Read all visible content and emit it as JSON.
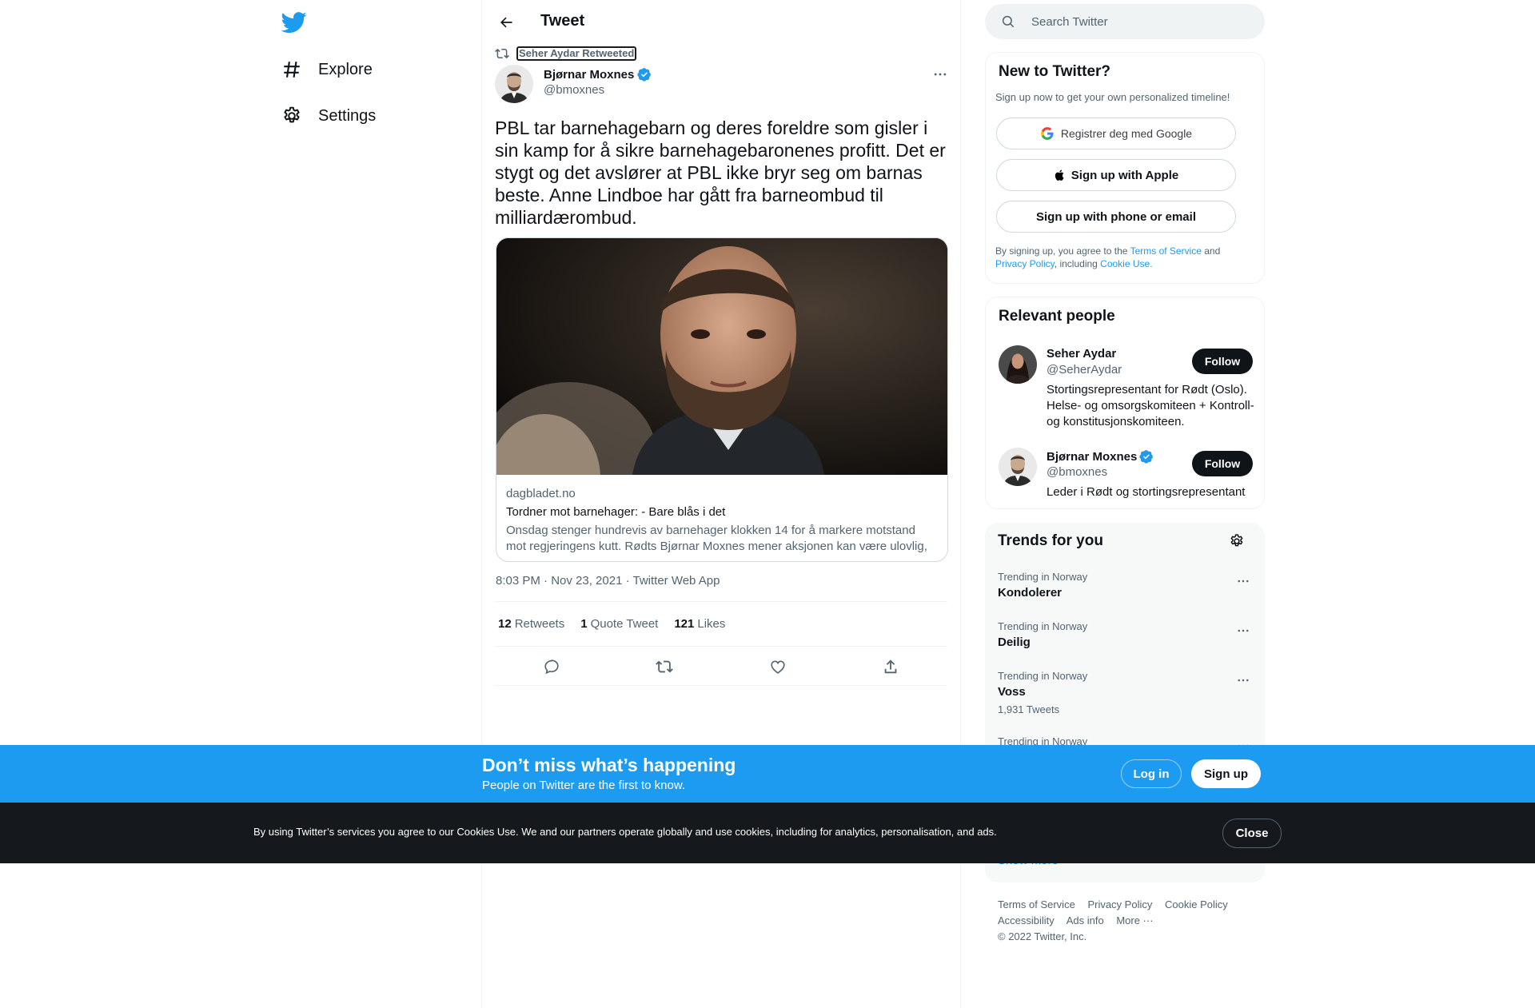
{
  "nav": {
    "logo": "twitter-bird-icon",
    "items": [
      {
        "label": "Explore",
        "icon": "hashtag-icon"
      },
      {
        "label": "Settings",
        "icon": "gear-icon"
      }
    ]
  },
  "header": {
    "title": "Tweet",
    "back_icon": "arrow-left-icon"
  },
  "tweet": {
    "retweeted_by": "Seher Aydar Retweeted",
    "author": {
      "name": "Bjørnar Moxnes",
      "handle": "@bmoxnes",
      "verified": true
    },
    "text": "PBL tar barnehagebarn og deres foreldre som gisler i sin kamp for å sikre barnehagebaronenes profitt. Det er stygt og det avslører at PBL ikke bryr seg om barnas beste. Anne Lindboe har gått fra barneombud til milliardærombud.",
    "card": {
      "domain": "dagbladet.no",
      "title": "Tordner mot barnehager: - Bare blås i det",
      "description": "Onsdag stenger hundrevis av barnehager klokken 14 for å markere motstand mot regjeringens kutt. Rødts Bjørnar Moxnes mener aksjonen kan være ulovlig, og ber barnehagene om å droppe den."
    },
    "meta": "8:03 PM · Nov 23, 2021 · Twitter Web App",
    "stats": {
      "retweets_count": "12",
      "retweets_label": "Retweets",
      "quotes_count": "1",
      "quotes_label": "Quote Tweet",
      "likes_count": "121",
      "likes_label": "Likes"
    },
    "actions": [
      "reply-icon",
      "retweet-icon",
      "like-icon",
      "share-icon"
    ]
  },
  "search": {
    "placeholder": "Search Twitter"
  },
  "new_to_twitter": {
    "title": "New to Twitter?",
    "subtitle": "Sign up now to get your own personalized timeline!",
    "google_label": "Registrer deg med Google",
    "apple_label": "Sign up with Apple",
    "phone_label": "Sign up with phone or email",
    "legal_prefix": "By signing up, you agree to the ",
    "terms": "Terms of Service",
    "and": " and",
    "privacy": "Privacy Policy",
    "including": ", including ",
    "cookie": "Cookie Use."
  },
  "relevant_people": {
    "title": "Relevant people",
    "people": [
      {
        "name": "Seher Aydar",
        "handle": "@SeherAydar",
        "verified": false,
        "bio": "Stortingsrepresentant for Rødt (Oslo). Helse- og omsorgskomiteen + Kontroll- og konstitusjonskomiteen.",
        "follow": "Follow"
      },
      {
        "name": "Bjørnar Moxnes",
        "handle": "@bmoxnes",
        "verified": true,
        "bio": "Leder i Rødt og stortingsrepresentant",
        "follow": "Follow"
      }
    ]
  },
  "trends": {
    "title": "Trends for you",
    "items": [
      {
        "context": "Trending in Norway",
        "name": "Kondolerer",
        "count": ""
      },
      {
        "context": "Trending in Norway",
        "name": "Deilig",
        "count": ""
      },
      {
        "context": "Trending in Norway",
        "name": "Voss",
        "count": "1,931 Tweets"
      },
      {
        "context": "Trending in Norway",
        "name": "",
        "count": ""
      }
    ],
    "show_more": "Show more"
  },
  "footer": {
    "links": [
      "Terms of Service",
      "Privacy Policy",
      "Cookie Policy",
      "Accessibility",
      "Ads info",
      "More ···"
    ],
    "copyright": "© 2022 Twitter, Inc."
  },
  "banner": {
    "title": "Don’t miss what’s happening",
    "subtitle": "People on Twitter are the first to know.",
    "login": "Log in",
    "signup": "Sign up"
  },
  "cookie_bar": {
    "text": "By using Twitter’s services you agree to our Cookies Use. We and our partners operate globally and use cookies, including for analytics, personalisation, and ads.",
    "close": "Close"
  },
  "colors": {
    "accent": "#1d9bf0",
    "text": "#0f1419",
    "muted": "#536471",
    "cookie_bg": "#15181c"
  }
}
